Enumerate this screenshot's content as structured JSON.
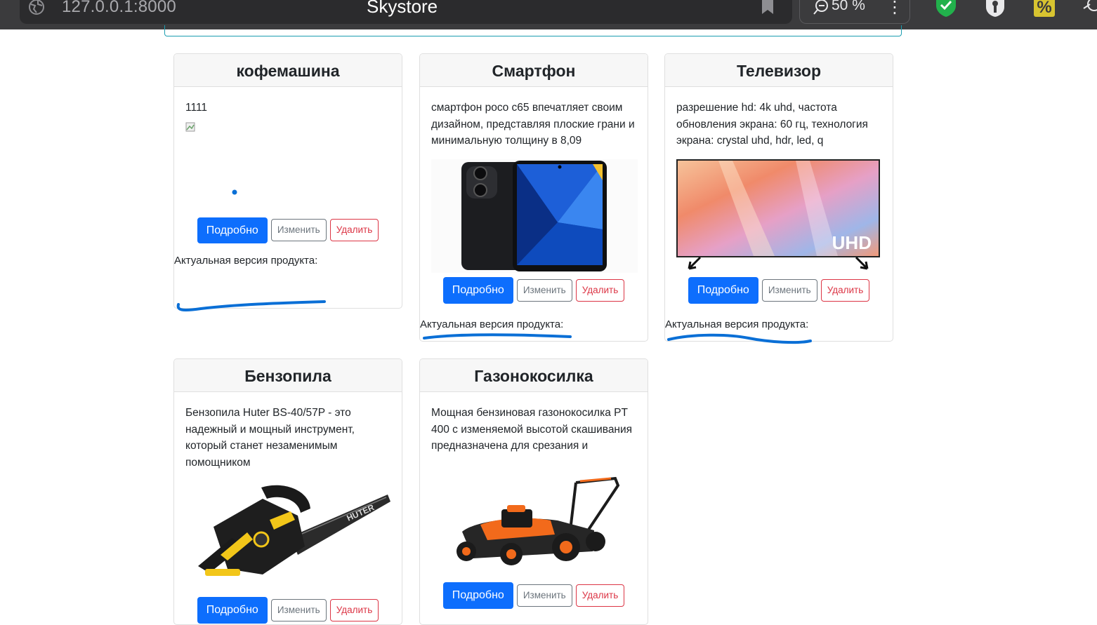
{
  "browser": {
    "url": "127.0.0.1:8000",
    "tab_title": "Skystore",
    "zoom": "50 %"
  },
  "colors": {
    "primary": "#0d6efd",
    "secondary": "#6c757d",
    "danger": "#dc3545",
    "ink": "#0a6fd6"
  },
  "products": [
    {
      "title": "кофемашина",
      "description": "1111",
      "image": "broken-image-icon",
      "buttons": {
        "details": "Подробно",
        "edit": "Изменить",
        "delete": "Удалить"
      },
      "version_label": "Актуальная версия продукта:"
    },
    {
      "title": "Смартфон",
      "description": "смартфон poco c65 впечатляет своим дизайном, представляя плоские грани и минимальную толщину в 8,09",
      "image": "smartphone-image",
      "buttons": {
        "details": "Подробно",
        "edit": "Изменить",
        "delete": "Удалить"
      },
      "version_label": "Актуальная версия продукта:"
    },
    {
      "title": "Телевизор",
      "description": "разрешение hd: 4k uhd, частота обновления экрана: 60 гц, технология экрана: crystal uhd, hdr, led, q",
      "image": "tv-image",
      "image_text": "UHD",
      "buttons": {
        "details": "Подробно",
        "edit": "Изменить",
        "delete": "Удалить"
      },
      "version_label": "Актуальная версия продукта:"
    },
    {
      "title": "Бензопила",
      "description": "Бензопила Huter BS-40/57P - это надежный и мощный инструмент, который станет незаменимым помощником",
      "image": "chainsaw-image",
      "image_text": "HUTER",
      "buttons": {
        "details": "Подробно",
        "edit": "Изменить",
        "delete": "Удалить"
      }
    },
    {
      "title": "Газонокосилка",
      "description": "Мощная бензиновая газонокосилка PT 400 с изменяемой высотой скашивания предназначена для срезания и",
      "image": "lawnmower-image",
      "buttons": {
        "details": "Подробно",
        "edit": "Изменить",
        "delete": "Удалить"
      }
    }
  ]
}
